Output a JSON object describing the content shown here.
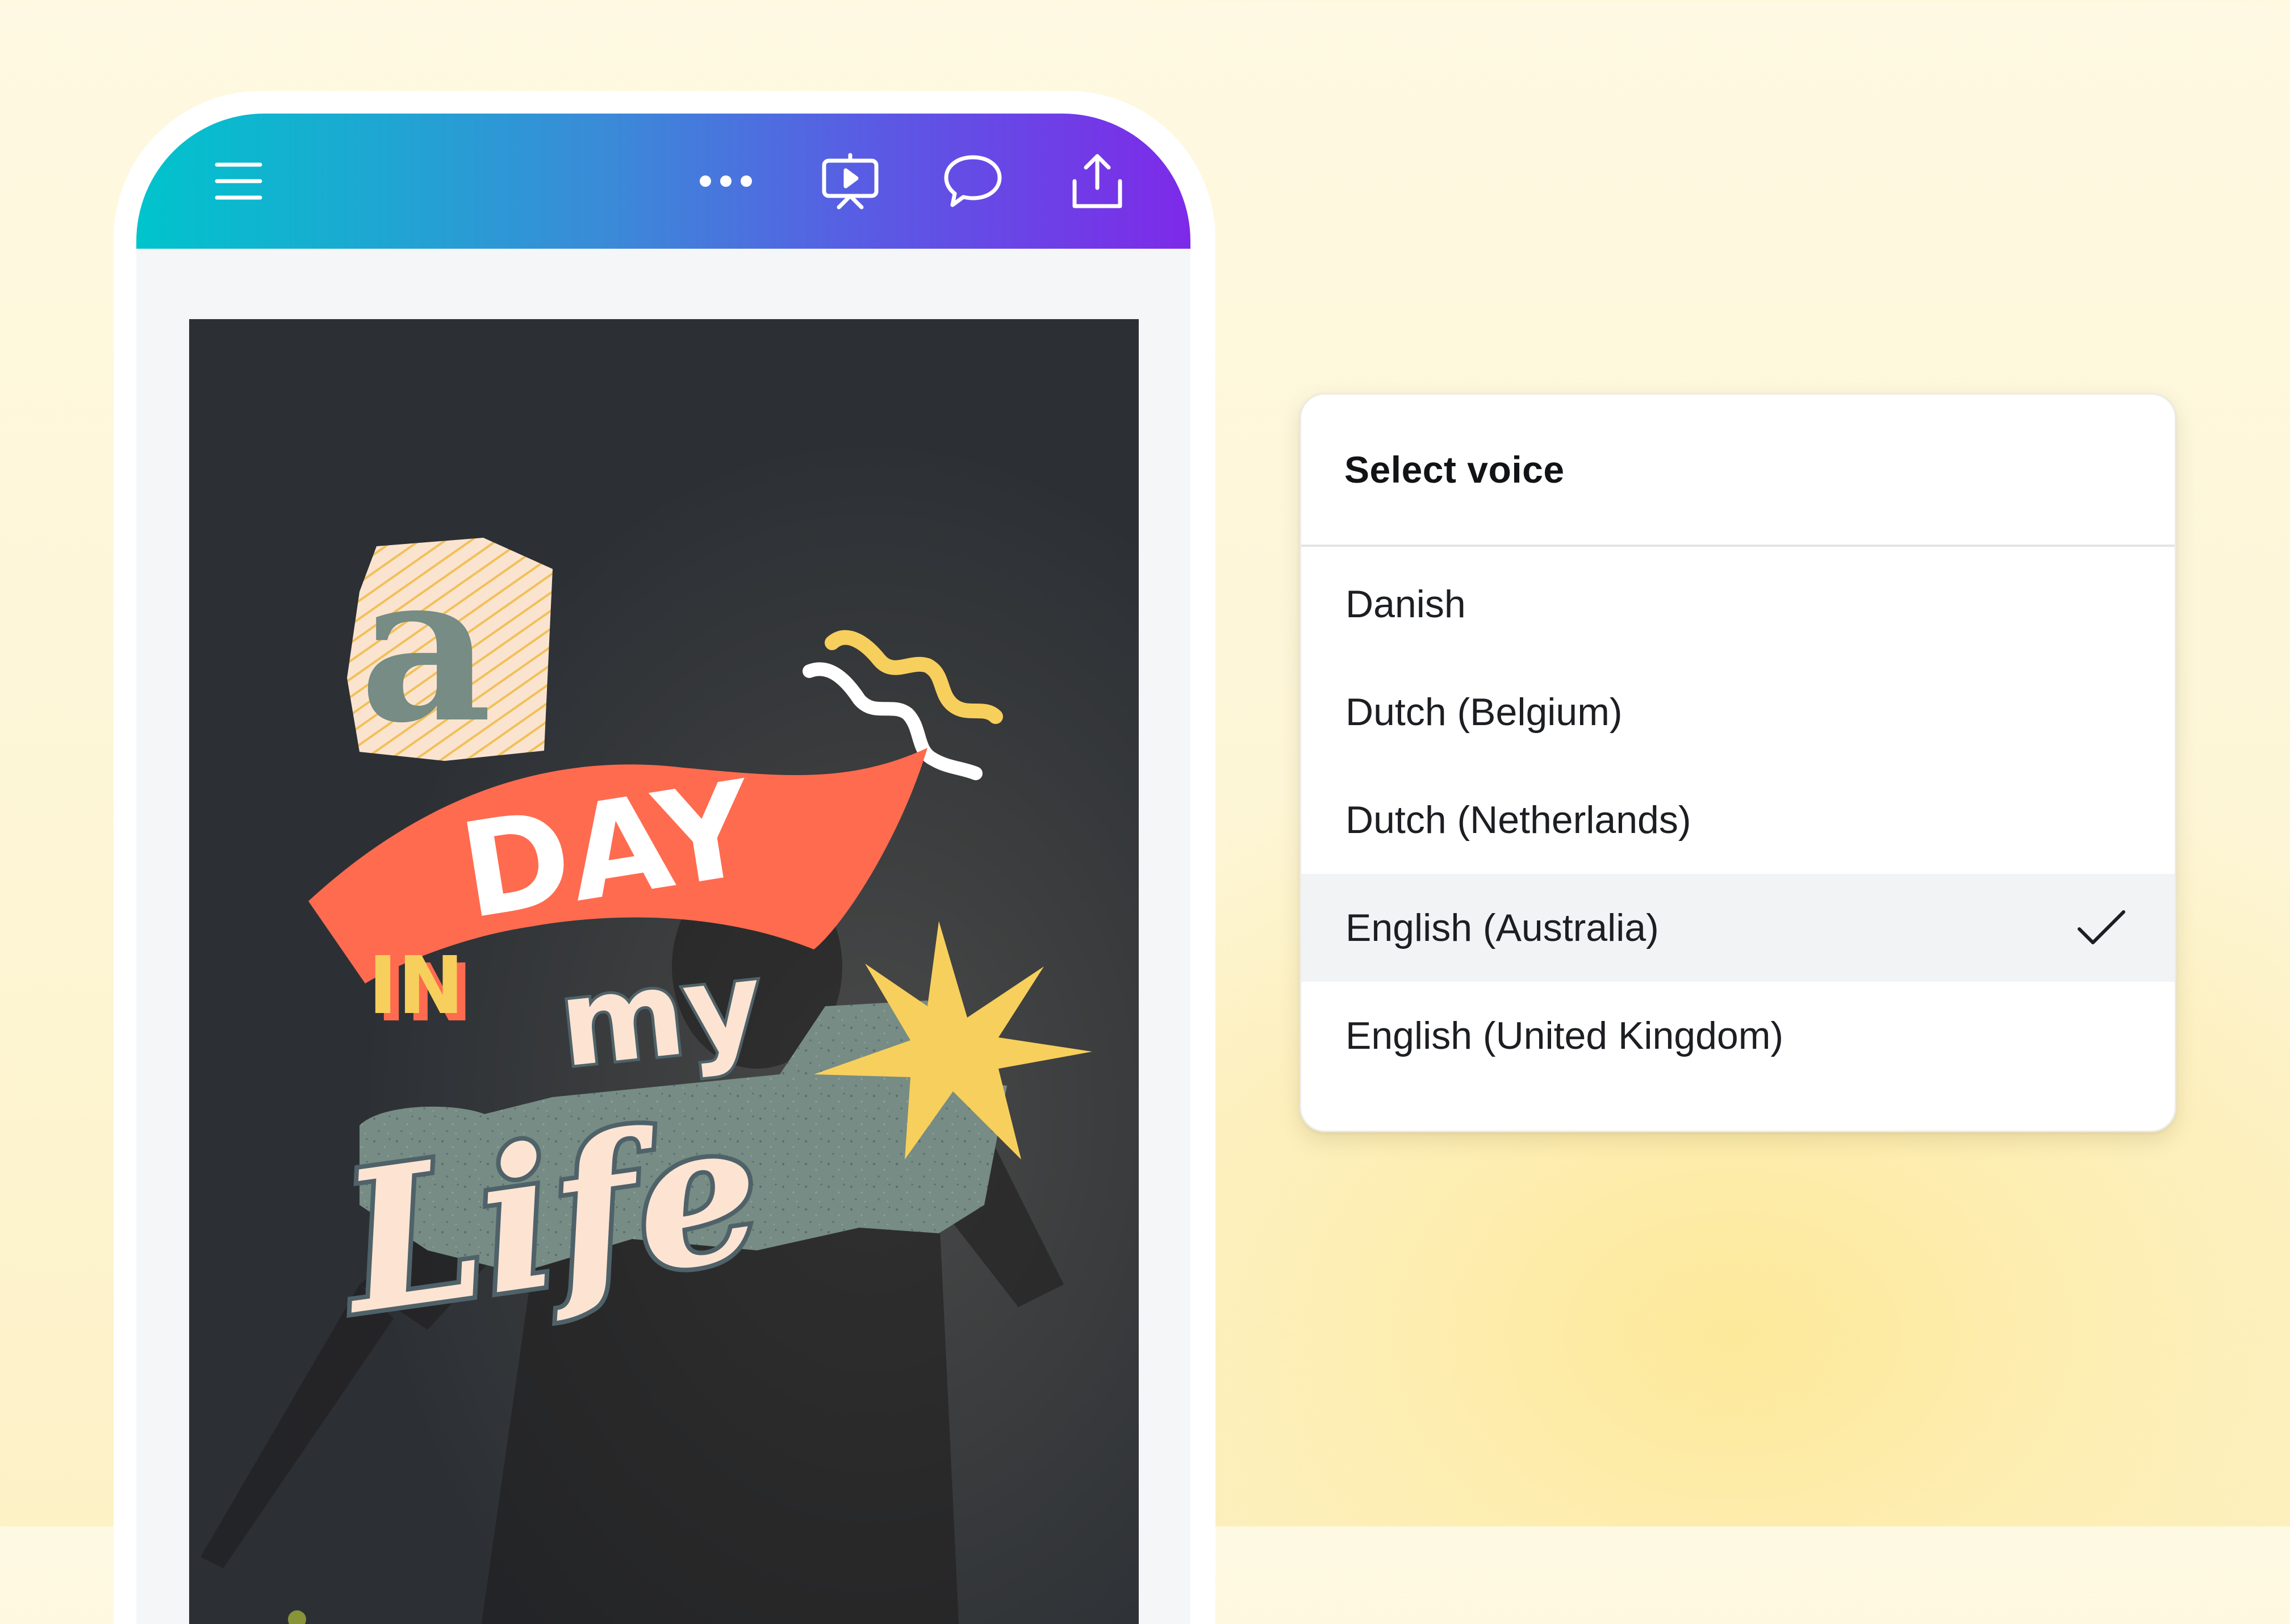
{
  "toolbar": {
    "menu_icon": "hamburger-menu-icon",
    "more_icon": "ellipsis-icon",
    "present_icon": "present-screen-icon",
    "comment_icon": "comment-bubble-icon",
    "share_icon": "share-upload-icon"
  },
  "design": {
    "letter_a": "a",
    "word_day": "DAY",
    "word_in": "IN",
    "word_my": "my",
    "word_life": "Life"
  },
  "voice_panel": {
    "title": "Select voice",
    "options": [
      {
        "label": "Danish",
        "selected": false
      },
      {
        "label": "Dutch (Belgium)",
        "selected": false
      },
      {
        "label": "Dutch (Netherlands)",
        "selected": false
      },
      {
        "label": "English (Australia)",
        "selected": true
      },
      {
        "label": "English (United Kingdom)",
        "selected": false
      }
    ]
  },
  "colors": {
    "gradient_start": "#00c4cc",
    "gradient_end": "#7d2ae8",
    "coral": "#ff6b4f",
    "sage": "#768c84",
    "yellow": "#f7cf5c",
    "cream": "#fde4d2"
  }
}
